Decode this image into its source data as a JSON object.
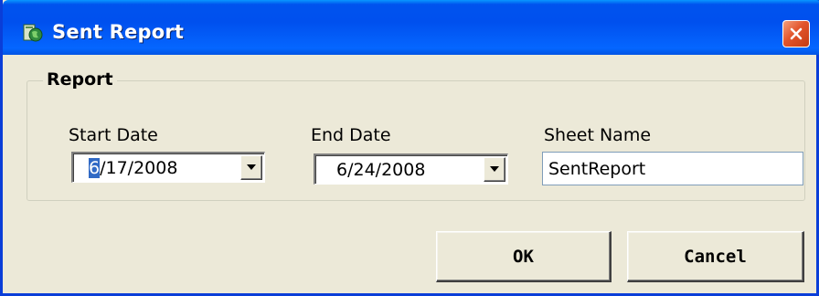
{
  "window": {
    "title": "Sent Report",
    "app_icon": "report-globe-icon",
    "close_icon": "close-icon"
  },
  "report_group": {
    "legend": "Report",
    "start_date": {
      "label": "Start Date",
      "value_selected": "6",
      "value_rest": "/17/2008"
    },
    "end_date": {
      "label": "End Date",
      "value": "6/24/2008"
    },
    "sheet_name": {
      "label": "Sheet Name",
      "value": "SentReport"
    }
  },
  "buttons": {
    "ok": "OK",
    "cancel": "Cancel"
  },
  "colors": {
    "titlebar": "#0054e3",
    "face": "#ece9d8",
    "close": "#e2542b",
    "selection": "#316ac5"
  }
}
